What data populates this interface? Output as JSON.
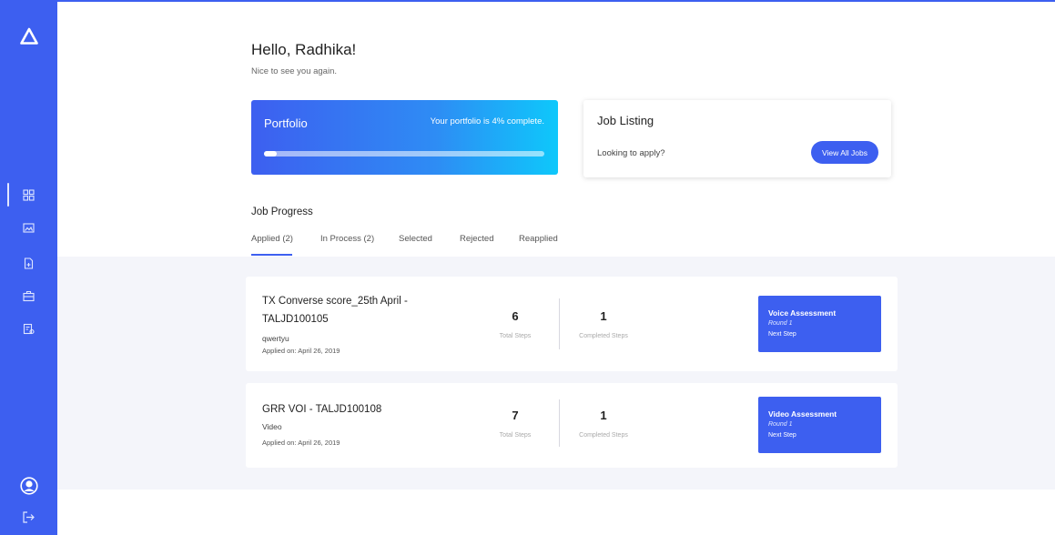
{
  "header": {
    "greeting": "Hello, Radhika!",
    "subtitle": "Nice to see you again."
  },
  "sidebar": {
    "logo": "triangle-logo-icon",
    "items": [
      {
        "icon": "dashboard-grid-icon",
        "active": true
      },
      {
        "icon": "portfolio-image-icon",
        "active": false
      },
      {
        "icon": "document-icon",
        "active": false
      },
      {
        "icon": "briefcase-icon",
        "active": false
      },
      {
        "icon": "certificate-icon",
        "active": false
      }
    ],
    "bottom": [
      "user-avatar-icon",
      "logout-icon"
    ]
  },
  "portfolio": {
    "title": "Portfolio",
    "status": "Your portfolio is 4% complete.",
    "progress_percent": 4
  },
  "job_listing": {
    "title": "Job Listing",
    "prompt": "Looking to apply?",
    "button": "View All Jobs"
  },
  "job_progress": {
    "title": "Job Progress",
    "tabs": [
      {
        "label": "Applied (2)",
        "active": true
      },
      {
        "label": "In Process (2)",
        "active": false
      },
      {
        "label": "Selected",
        "active": false
      },
      {
        "label": "Rejected",
        "active": false
      },
      {
        "label": "Reapplied",
        "active": false
      }
    ]
  },
  "jobs": [
    {
      "title_line1": "TX Converse score_25th April -",
      "title_line2": "TALJD100105",
      "subtitle": "qwertyu",
      "applied": "Applied on: April 26, 2019",
      "total_steps": "6",
      "total_steps_label": "Total Steps",
      "completed_steps": "1",
      "completed_steps_label": "Completed Steps",
      "next_step_title": "Voice Assessment",
      "next_step_round": "Round 1",
      "next_step_label": "Next Step"
    },
    {
      "title_line1": "GRR VOI - TALJD100108",
      "subtitle": "Video",
      "applied": "Applied on: April 26, 2019",
      "total_steps": "7",
      "total_steps_label": "Total Steps",
      "completed_steps": "1",
      "completed_steps_label": "Completed Steps",
      "next_step_title": "Video Assessment",
      "next_step_round": "Round 1",
      "next_step_label": "Next Step"
    }
  ],
  "colors": {
    "accent": "#3d5ff0",
    "gradient_end": "#0ec8fb",
    "band": "#f4f5fa"
  }
}
